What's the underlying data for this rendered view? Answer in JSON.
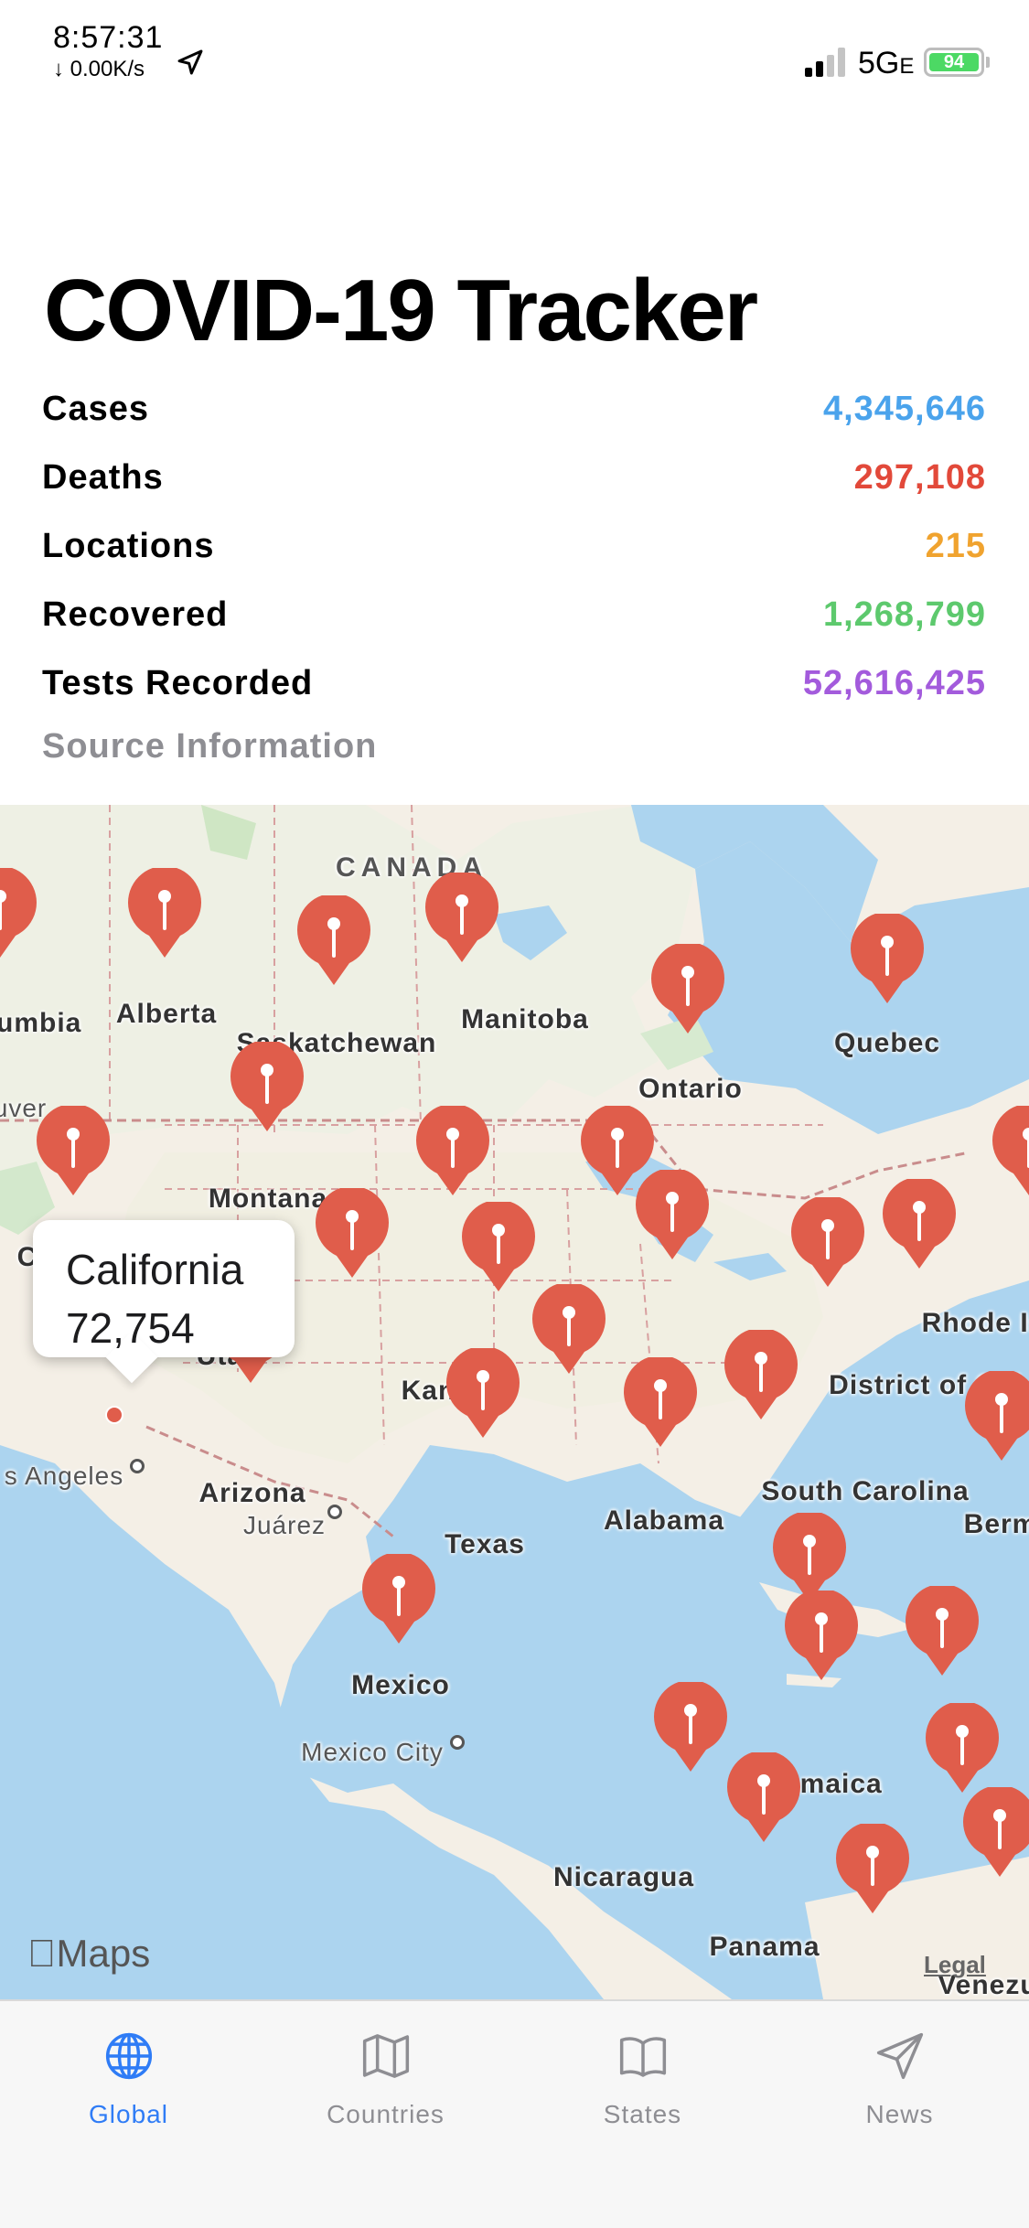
{
  "status_bar": {
    "time": "8:57:31",
    "speed": "↓ 0.00K/s",
    "network": "5G",
    "network_suffix": "E",
    "battery": "94",
    "icons": [
      "location-arrow-icon",
      "signal-icon",
      "battery-icon"
    ]
  },
  "title": "COVID-19 Tracker",
  "stats": [
    {
      "label": "Cases",
      "value": "4,345,646",
      "color": "#4aa3ec"
    },
    {
      "label": "Deaths",
      "value": "297,108",
      "color": "#e2493a"
    },
    {
      "label": "Locations",
      "value": "215",
      "color": "#f0a32f"
    },
    {
      "label": "Recovered",
      "value": "1,268,799",
      "color": "#5dc96d"
    },
    {
      "label": "Tests Recorded",
      "value": "52,616,425",
      "color": "#a35bdc"
    }
  ],
  "source_link": "Source Information",
  "map": {
    "labels": {
      "canada": "CANADA",
      "columbia": "lumbia",
      "alberta": "Alberta",
      "saskatchewan": "Saskatchewan",
      "manitoba": "Manitoba",
      "ontario": "Ontario",
      "quebec": "Quebec",
      "vancouver": "uver",
      "montana": "Montana",
      "utah": "Utah",
      "kansas": "Kansas",
      "rhode_island": "Rhode Is",
      "district_of_columbia": "District of Col",
      "los_angeles": "s Angeles",
      "arizona": "Arizona",
      "juarez": "Juárez",
      "texas": "Texas",
      "alabama": "Alabama",
      "south_carolina": "South Carolina",
      "bermuda": "Berm",
      "mexico": "Mexico",
      "mexico_city": "Mexico City",
      "jamaica": "Jamaica",
      "nicaragua": "Nicaragua",
      "panama": "Panama",
      "venezuela": "Venezu",
      "oregon_partial": "C"
    },
    "callout": {
      "title": "California",
      "value": "72,754"
    },
    "brand": "Maps",
    "legal": "Legal",
    "pin_color": "#e05d4b"
  },
  "tabs": [
    {
      "label": "Global",
      "icon": "globe-icon",
      "active": true
    },
    {
      "label": "Countries",
      "icon": "map-icon",
      "active": false
    },
    {
      "label": "States",
      "icon": "book-icon",
      "active": false
    },
    {
      "label": "News",
      "icon": "paper-plane-icon",
      "active": false
    }
  ]
}
